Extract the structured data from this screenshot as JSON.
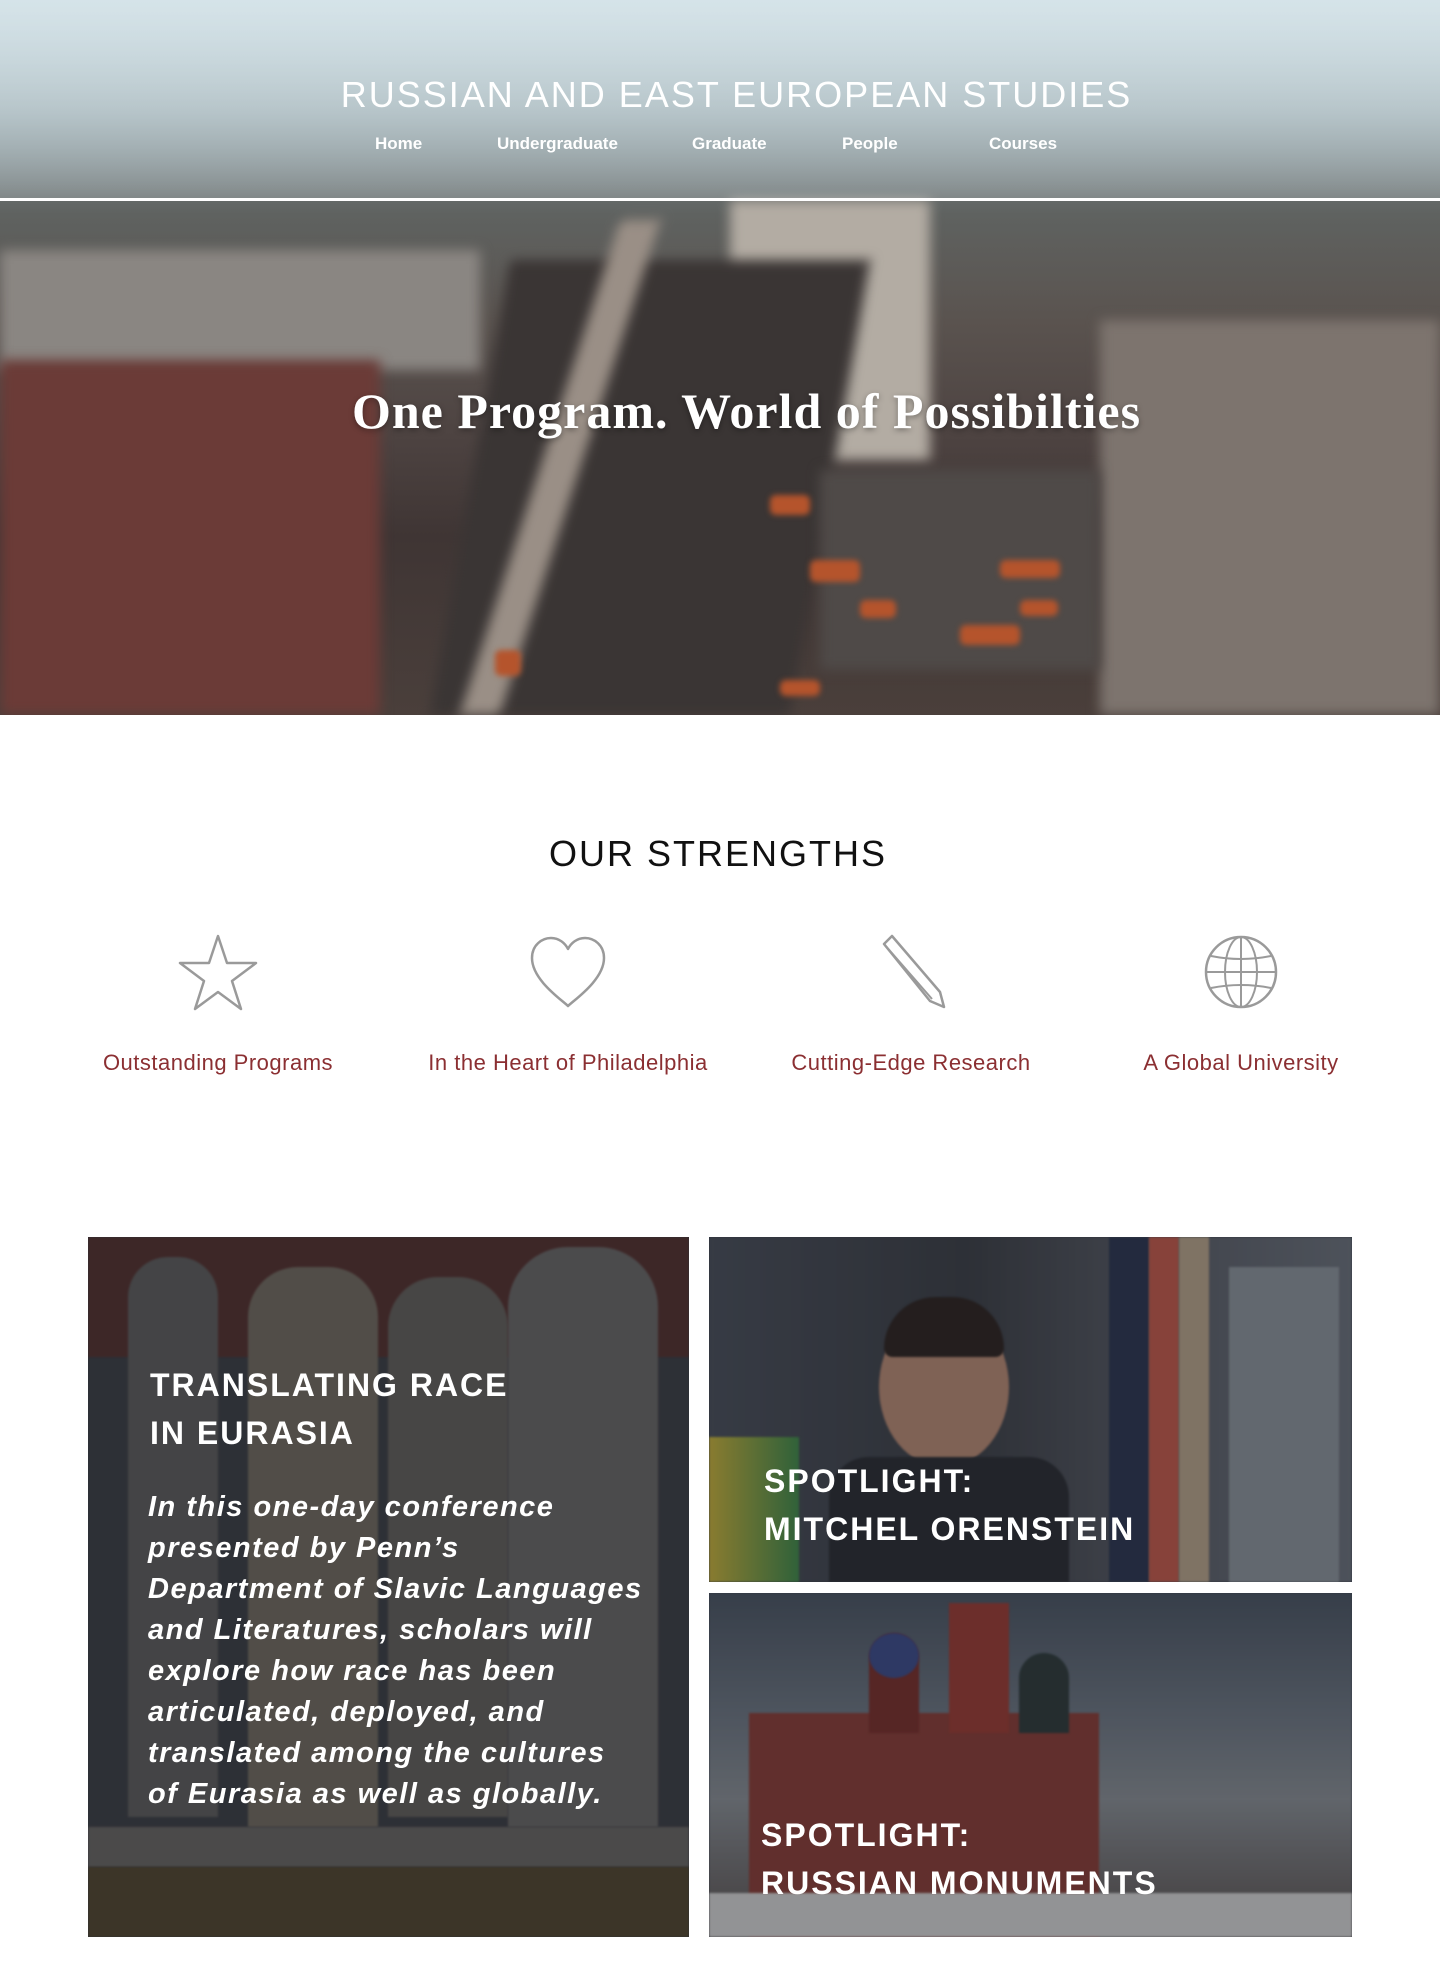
{
  "site": {
    "title": "RUSSIAN AND EAST EUROPEAN STUDIES",
    "nav": [
      "Home",
      "Undergraduate",
      "Graduate",
      "People",
      "Courses"
    ]
  },
  "hero": {
    "headline": "One Program. World of Possibilties"
  },
  "strengths": {
    "title": "OUR STRENGTHS",
    "items": [
      {
        "label": "Outstanding Programs",
        "icon": "star-icon"
      },
      {
        "label": "In the Heart of Philadelphia",
        "icon": "heart-icon"
      },
      {
        "label": "Cutting-Edge Research",
        "icon": "pencil-icon"
      },
      {
        "label": "A Global University",
        "icon": "globe-icon"
      }
    ]
  },
  "features": {
    "main": {
      "heading_line1": "TRANSLATING RACE",
      "heading_line2": "IN EURASIA",
      "body_lines": [
        "In this one-day conference",
        "presented by Penn’s",
        "Department of Slavic Languages",
        "and Literatures, scholars will",
        "explore how race has been",
        "articulated, deployed, and",
        "translated among the cultures",
        "of Eurasia as well as globally."
      ]
    },
    "spotlight1": {
      "line1": "SPOTLIGHT:",
      "line2": "MITCHEL ORENSTEIN"
    },
    "spotlight2": {
      "line1": "SPOTLIGHT:",
      "line2": "RUSSIAN MONUMENTS"
    }
  },
  "colors": {
    "accent": "#8b2f32",
    "icon_stroke": "#9a9a9a"
  }
}
